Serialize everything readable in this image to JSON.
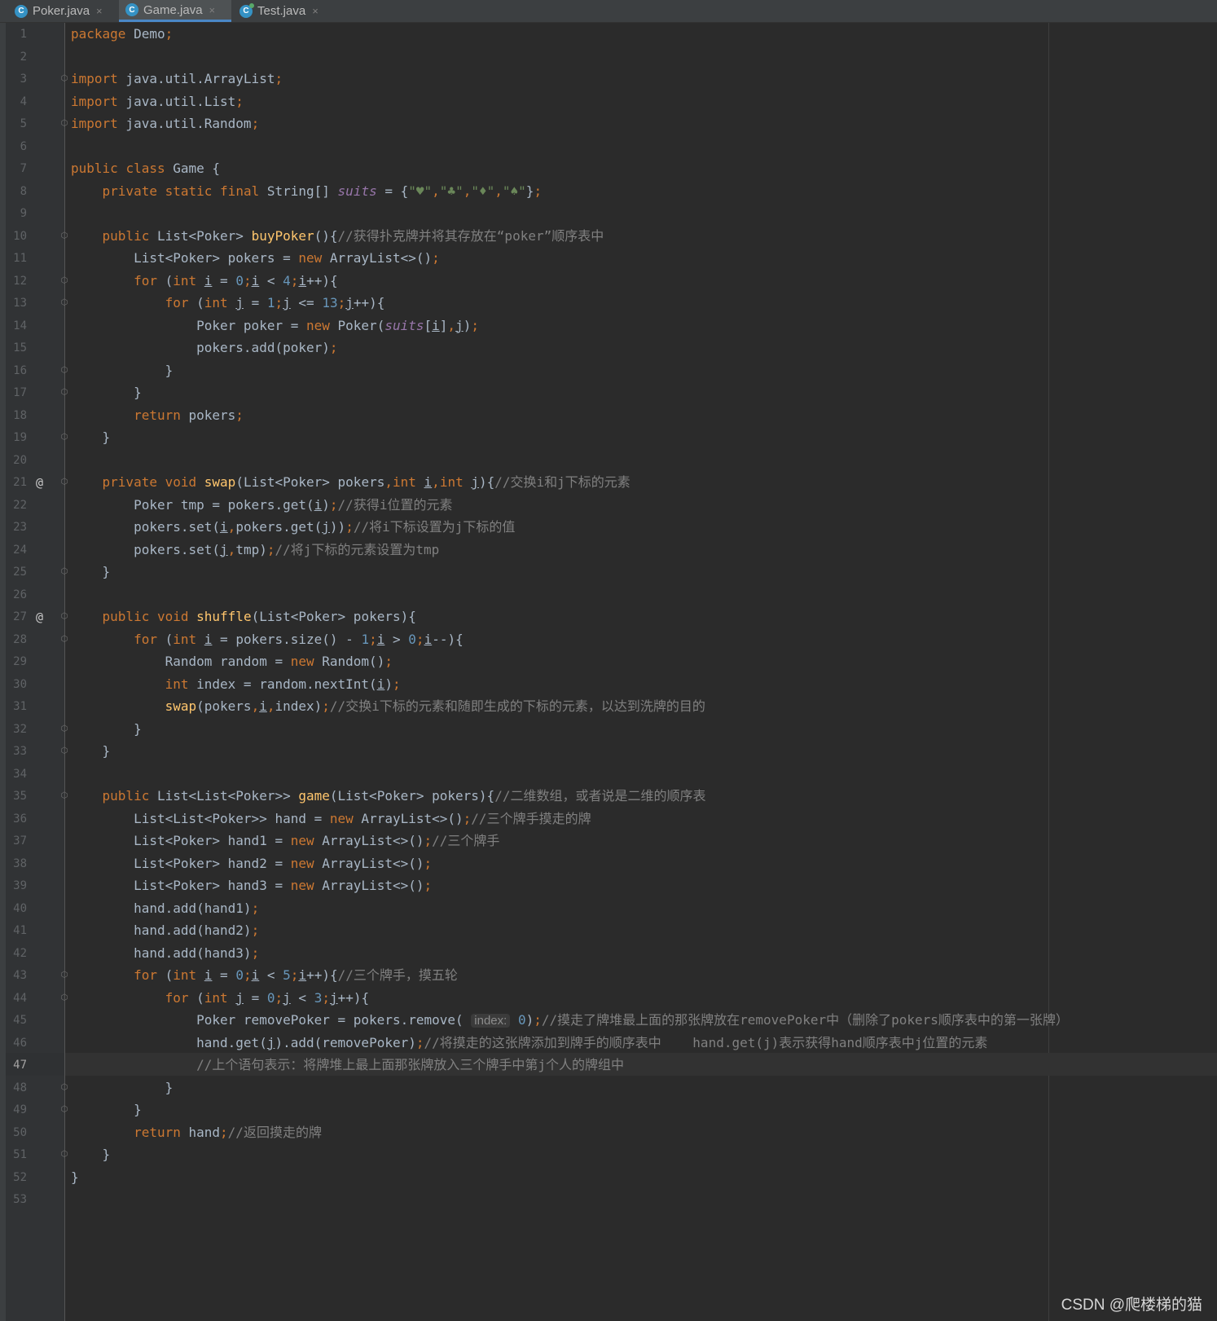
{
  "tabs": [
    {
      "name": "Poker.java",
      "icon": "C",
      "active": false
    },
    {
      "name": "Game.java",
      "icon": "C",
      "active": true
    },
    {
      "name": "Test.java",
      "icon": "C",
      "active": false
    }
  ],
  "tab_close_glyph": "×",
  "current_line": 47,
  "override_marker": "@",
  "code_lines": [
    "package Demo;",
    "",
    "import java.util.ArrayList;",
    "import java.util.List;",
    "import java.util.Random;",
    "",
    "public class Game {",
    "    private static final String[] suits = {\"♥\",\"♣\",\"♦\",\"♠\"};",
    "",
    "    public List<Poker> buyPoker(){//获得扑克牌并将其存放在“poker”顺序表中",
    "        List<Poker> pokers = new ArrayList<>();",
    "        for (int i = 0;i < 4;i++){",
    "            for (int j = 1;j <= 13;j++){",
    "                Poker poker = new Poker(suits[i],j);",
    "                pokers.add(poker);",
    "            }",
    "        }",
    "        return pokers;",
    "    }",
    "",
    "    private void swap(List<Poker> pokers,int i,int j){//交换i和j下标的元素",
    "        Poker tmp = pokers.get(i);//获得i位置的元素",
    "        pokers.set(i,pokers.get(j));//将i下标设置为j下标的值",
    "        pokers.set(j,tmp);//将j下标的元素设置为tmp",
    "    }",
    "",
    "    public void shuffle(List<Poker> pokers){",
    "        for (int i = pokers.size() - 1;i > 0;i--){",
    "            Random random = new Random();",
    "            int index = random.nextInt(i);",
    "            swap(pokers,i,index);//交换i下标的元素和随即生成的下标的元素，以达到洗牌的目的",
    "        }",
    "    }",
    "",
    "    public List<List<Poker>> game(List<Poker> pokers){//二维数组，或者说是二维的顺序表",
    "        List<List<Poker>> hand = new ArrayList<>();//三个牌手摸走的牌",
    "        List<Poker> hand1 = new ArrayList<>();//三个牌手",
    "        List<Poker> hand2 = new ArrayList<>();",
    "        List<Poker> hand3 = new ArrayList<>();",
    "        hand.add(hand1);",
    "        hand.add(hand2);",
    "        hand.add(hand3);",
    "        for (int i = 0;i < 5;i++){//三个牌手，摸五轮",
    "            for (int j = 0;j < 3;j++){",
    "                Poker removePoker = pokers.remove( index: 0);//摸走了牌堆最上面的那张牌放在removePoker中（删除了pokers顺序表中的第一张牌）",
    "                hand.get(j).add(removePoker);//将摸走的这张牌添加到牌手的顺序表中    hand.get(j)表示获得hand顺序表中j位置的元素",
    "                //上个语句表示：将牌堆上最上面那张牌放入三个牌手中第j个人的牌组中",
    "            }",
    "        }",
    "        return hand;//返回摸走的牌",
    "    }",
    "}",
    ""
  ],
  "watermark": "CSDN @爬楼梯的猫"
}
